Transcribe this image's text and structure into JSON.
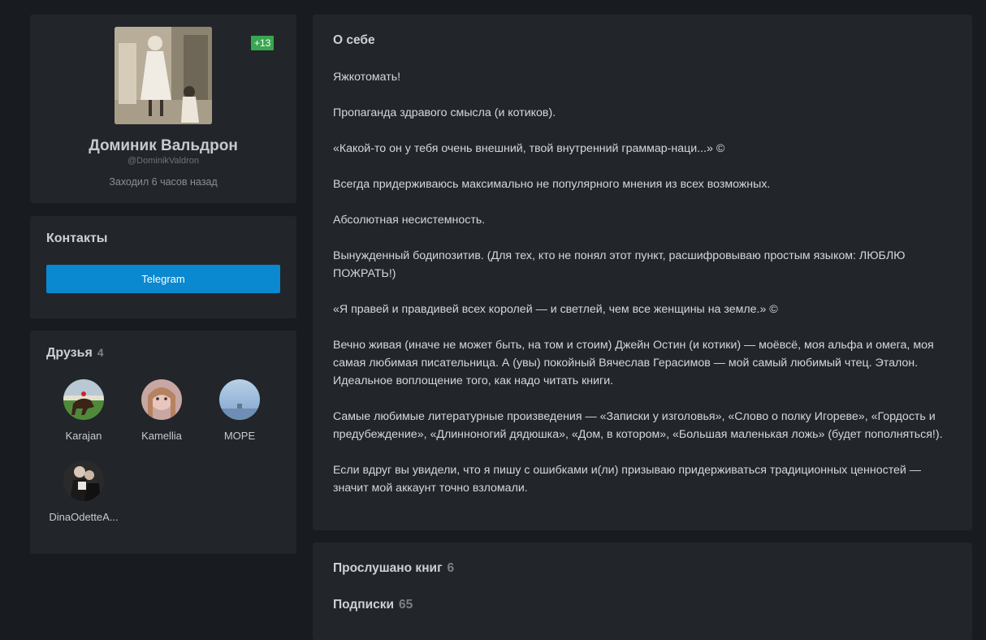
{
  "profile": {
    "name": "Доминик Вальдрон",
    "handle": "@DominikValdron",
    "last_seen": "Заходил 6 часов назад",
    "rating": "+13"
  },
  "contacts": {
    "title": "Контакты",
    "telegram_label": "Telegram"
  },
  "friends": {
    "title": "Друзья",
    "count": "4",
    "items": [
      {
        "name": "Karajan"
      },
      {
        "name": "Kamellia"
      },
      {
        "name": "МОРЕ"
      },
      {
        "name": "DinaOdetteA..."
      }
    ]
  },
  "about": {
    "title": "О себе",
    "paragraphs": [
      "Яжкотомать!",
      "Пропаганда здравого смысла (и котиков).",
      "«Какой-то он у тебя очень внешний, твой внутренний граммар-наци...» ©",
      "Всегда придерживаюсь максимально не популярного мнения из всех возможных.",
      "Абсолютная несистемность.",
      "Вынужденный бодипозитив. (Для тех, кто не понял этот пункт, расшифровываю простым языком: ЛЮБЛЮ ПОЖРАТЬ!)",
      "«Я правей и правдивей всех королей — и светлей, чем все женщины на земле.» ©",
      "Вечно живая (иначе не может быть, на том и стоим) Джейн Остин (и котики) — моёвсё, моя альфа и омега, моя самая любимая писательница. А (увы) покойный Вячеслав Герасимов — мой самый любимый чтец. Эталон. Идеальное воплощение того, как надо читать книги.",
      "Самые любимые литературные произведения — «Записки у изголовья», «Слово о полку Игореве», «Гордость и предубеждение», «Длинноногий дядюшка», «Дом, в котором», «Большая маленькая ложь» (будет пополняться!).",
      "Если вдруг вы увидели, что я пишу с ошибками и(ли) призываю придерживаться традиционных ценностей — значит мой аккаунт точно взломали."
    ]
  },
  "stats": {
    "listened_label": "Прослушано книг",
    "listened_count": "6",
    "subscriptions_label": "Подписки",
    "subscriptions_count": "65"
  },
  "colors": {
    "background": "#181c21",
    "card": "#22262b",
    "telegram": "#0a88d0",
    "rating": "#3aa651"
  }
}
